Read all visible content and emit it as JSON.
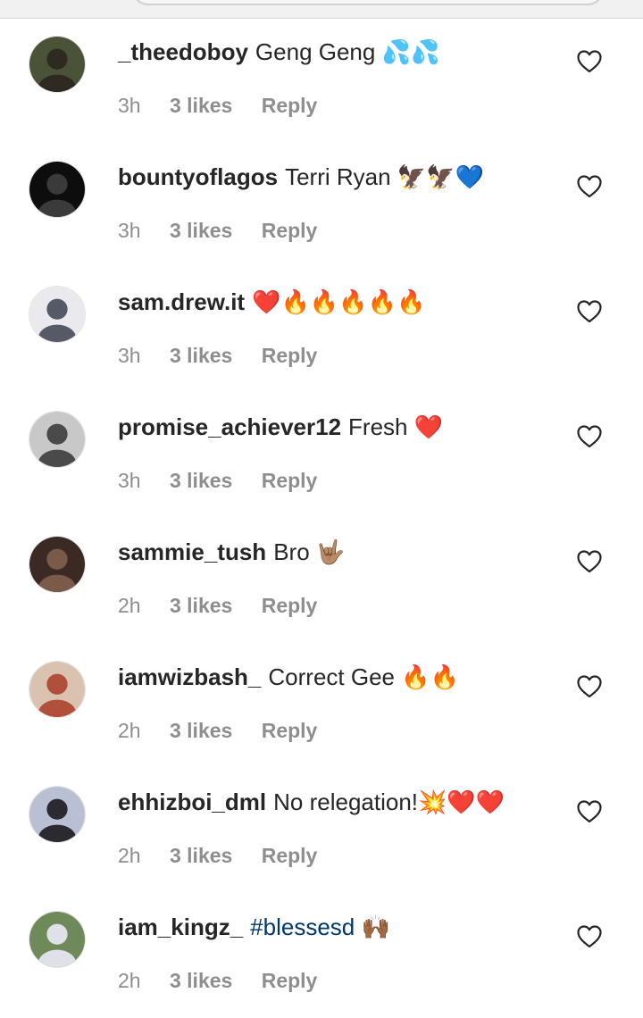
{
  "comments": [
    {
      "username": "_theedoboy",
      "text": "Geng Geng 💦💦",
      "time": "3h",
      "likes": "3 likes",
      "reply": "Reply",
      "avatar": {
        "bg": "#4a5238",
        "fg": "#2e2a22"
      }
    },
    {
      "username": "bountyoflagos",
      "text": "Terri Ryan 🦅🦅💙",
      "time": "3h",
      "likes": "3 likes",
      "reply": "Reply",
      "avatar": {
        "bg": "#0d0d0d",
        "fg": "#3a3a3a"
      }
    },
    {
      "username": "sam.drew.it",
      "text": "❤️🔥🔥🔥🔥🔥",
      "time": "3h",
      "likes": "3 likes",
      "reply": "Reply",
      "avatar": {
        "bg": "#e9e9ee",
        "fg": "#555a66"
      }
    },
    {
      "username": "promise_achiever12",
      "text": "Fresh ❤️",
      "time": "3h",
      "likes": "3 likes",
      "reply": "Reply",
      "avatar": {
        "bg": "#c8c8c8",
        "fg": "#4a4a4a"
      }
    },
    {
      "username": "sammie_tush",
      "text": "Bro 🤟🏽",
      "time": "2h",
      "likes": "3 likes",
      "reply": "Reply",
      "avatar": {
        "bg": "#3b2a24",
        "fg": "#7a5a48"
      }
    },
    {
      "username": "iamwizbash_",
      "text": "Correct Gee 🔥🔥",
      "time": "2h",
      "likes": "3 likes",
      "reply": "Reply",
      "avatar": {
        "bg": "#d9c2b0",
        "fg": "#b0503a"
      }
    },
    {
      "username": "ehhizboi_dml",
      "text": "No relegation!💥❤️❤️",
      "time": "2h",
      "likes": "3 likes",
      "reply": "Reply",
      "avatar": {
        "bg": "#b9c0d4",
        "fg": "#2a2a30"
      }
    },
    {
      "username": "iam_kingz_",
      "text": "#blessesd 🙌🏾",
      "time": "2h",
      "likes": "3 likes",
      "reply": "Reply",
      "link": true,
      "avatar": {
        "bg": "#6f8a5a",
        "fg": "#e0e0e8"
      }
    }
  ],
  "icons": {
    "like": "heart-outline-icon"
  },
  "colors": {
    "username": "#262626",
    "meta": "#8e8e8e",
    "hashtag": "#00376b"
  }
}
